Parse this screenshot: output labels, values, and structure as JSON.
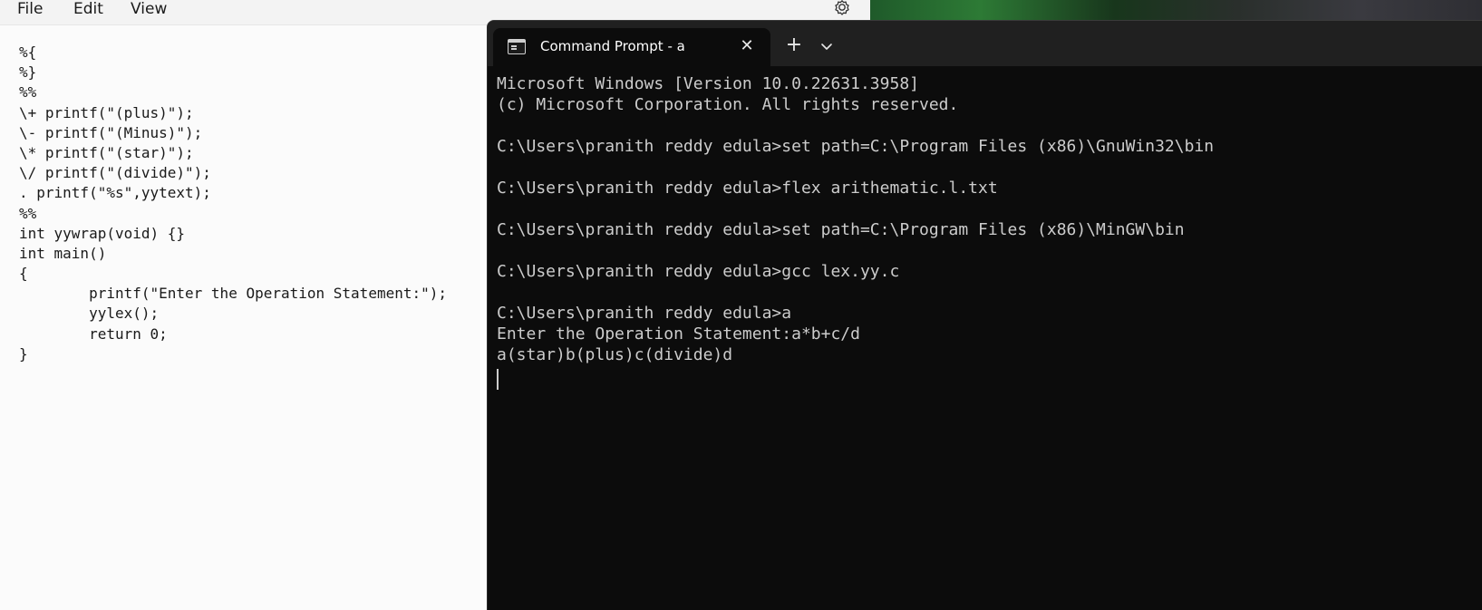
{
  "notepad": {
    "menu": {
      "file": "File",
      "edit": "Edit",
      "view": "View"
    },
    "code_lines": [
      "%{",
      "%}",
      "%%",
      "\\+ printf(\"(plus)\");",
      "\\- printf(\"(Minus)\");",
      "\\* printf(\"(star)\");",
      "\\/ printf(\"(divide)\");",
      ". printf(\"%s\",yytext);",
      "%%",
      "int yywrap(void) {}",
      "int main()",
      "{",
      "        printf(\"Enter the Operation Statement:\");",
      "        yylex();",
      "        return 0;",
      "}"
    ]
  },
  "terminal": {
    "tab_title": "Command Prompt - a",
    "icons": {
      "tab": "terminal-icon",
      "close": "close-icon",
      "new_tab": "plus-icon",
      "dropdown": "chevron-down-icon"
    },
    "lines": [
      "Microsoft Windows [Version 10.0.22631.3958]",
      "(c) Microsoft Corporation. All rights reserved.",
      "",
      "C:\\Users\\pranith reddy edula>set path=C:\\Program Files (x86)\\GnuWin32\\bin",
      "",
      "C:\\Users\\pranith reddy edula>flex arithematic.l.txt",
      "",
      "C:\\Users\\pranith reddy edula>set path=C:\\Program Files (x86)\\MinGW\\bin",
      "",
      "C:\\Users\\pranith reddy edula>gcc lex.yy.c",
      "",
      "C:\\Users\\pranith reddy edula>a",
      "Enter the Operation Statement:a*b+c/d",
      "a(star)b(plus)c(divide)d"
    ]
  },
  "colors": {
    "terminal_bg": "#0c0c0c",
    "terminal_text": "#cccccc",
    "titlebar": "#202020",
    "notepad_bg": "#fbfbfb"
  }
}
